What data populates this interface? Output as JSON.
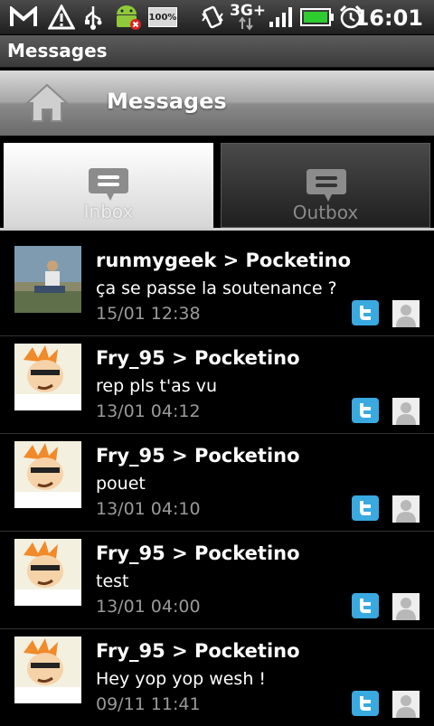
{
  "status_bar": {
    "time": "16:01",
    "network": "3G+",
    "battery_badge": "100%",
    "icons": [
      "gmail-icon",
      "warning-icon",
      "usb-icon",
      "android-debug-icon",
      "battery-badge-icon",
      "vibrate-icon",
      "network-icon",
      "signal-icon",
      "battery-icon",
      "alarm-icon"
    ]
  },
  "titlebar": {
    "title": "Messages"
  },
  "header": {
    "title": "Messages",
    "home_icon": "home-icon"
  },
  "tabs": [
    {
      "label": "Inbox",
      "icon": "message-icon",
      "selected": true
    },
    {
      "label": "Outbox",
      "icon": "message-icon",
      "selected": false
    }
  ],
  "messages": [
    {
      "from": "runmygeek > Pocketino",
      "body": "ça se passe la soutenance ?",
      "date": "15/01 12:38",
      "avatar": "photo"
    },
    {
      "from": "Fry_95 > Pocketino",
      "body": "rep pls t'as vu",
      "date": "13/01 04:12",
      "avatar": "fry"
    },
    {
      "from": "Fry_95 > Pocketino",
      "body": "pouet",
      "date": "13/01 04:10",
      "avatar": "fry"
    },
    {
      "from": "Fry_95 > Pocketino",
      "body": "test",
      "date": "13/01 04:00",
      "avatar": "fry"
    },
    {
      "from": "Fry_95 > Pocketino",
      "body": "Hey yop yop wesh !",
      "date": "09/11 11:41",
      "avatar": "fry"
    }
  ],
  "colors": {
    "twitter_blue": "#39a9e0",
    "date_gray": "#9a9a9a",
    "battery_green": "#2ecc2e"
  }
}
